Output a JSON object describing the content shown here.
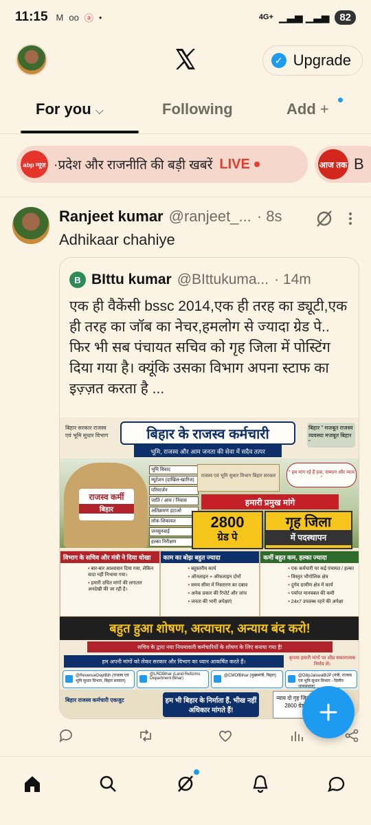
{
  "status_bar": {
    "time": "11:15",
    "network": "4G+",
    "battery": "82"
  },
  "header": {
    "upgrade_label": "Upgrade"
  },
  "tabs": {
    "for_you": "For you",
    "following": "Following",
    "add": "Add"
  },
  "news_banner": {
    "channel": "abp न्यूज़",
    "text": "·प्रदेश और राजनीति की बड़ी खबरें",
    "live": "LIVE",
    "second_channel": "आज तक",
    "second_text": "B"
  },
  "tweet": {
    "author_name": "Ranjeet kumar",
    "author_handle": "@ranjeet_...",
    "time": "· 8s",
    "text": "Adhikaar chahiye"
  },
  "quote": {
    "avatar_letter": "B",
    "author_name": "BIttu kumar",
    "author_handle": "@BIttukuma...",
    "time": "· 14m",
    "text": "एक ही वैकेंसी bssc 2014,एक ही तरह का ड्यूटी,एक ही तरह का जॉब का नेचर,हमलोग से ज्यादा ग्रेड पे.. फिर भी सब पंचायत सचिव को गृह जिला में पोस्टिंग दिया गया है। क्यूंकि उसका विभाग अपना स्टाफ का इज़्ज़त करता है ..."
  },
  "poster": {
    "gov_label": "बिहार सरकार राजस्व एवं भूमि सुधार विभाग",
    "title": "बिहार के राजस्व कर्मचारी",
    "subtitle": "भूमि, राजस्व और आम जनता की सेवा में सदैव तत्पर",
    "map_text": "बिहार \" मजबूत राजस्व व्यवस्था मजबूत बिहार \"",
    "man_label_top": "राजस्व कर्मी",
    "man_label_bottom": "बिहार",
    "signs": [
      "भूमि विवाद",
      "म्यूटेशन (दाखिल-खारिज)",
      "परिमार्जन",
      "जाति / आय / निवास",
      "अतिक्रमण हटाओ",
      "लोक शिकायत",
      "जनसुनवाई",
      "हल्का निरीक्षण"
    ],
    "building": "राजस्व एवं भूमि सुधार विभाग बिहार सरकार",
    "slogan": "\" हम मांग रहे हैं हक, सम्मान और न्याय \"",
    "demand_title": "हमारी प्रमुख मांगे",
    "demand1_big": "2800",
    "demand1_small": "ग्रेड पे",
    "demand2_big": "गृह जिला",
    "demand2_small": "में पदस्थापन",
    "col1_title": "विभाग के सचिव और मंत्री ने दिया धोखा",
    "col1_items": [
      "बार-बार आश्वासन दिया गया, लेकिन वादा नहीं निभाया गया।",
      "हमारी उचित मांगों की लगातार अनदेखी की जा रही है।"
    ],
    "col2_title": "काम का बोझ बहुत ज्यादा",
    "col2_items": [
      "बहुस्तरीय कार्य",
      "ऑनलाइन + ऑफलाइन दोनों",
      "समय सीमा में निस्तारण का दबाव",
      "अनेक प्रकार की रिपोर्ट और जांच",
      "जनता की भारी अपेक्षाएं"
    ],
    "col3_title": "कर्मी बहुत कम, हल्का ज्यादा",
    "col3_items": [
      "एक कर्मचारी पर कई पंचायत / हल्का",
      "विस्तृत भौगोलिक क्षेत्र",
      "दुर्गम ग्रामीण क्षेत्र में कार्य",
      "पर्याप्त मानवबल की कमी",
      "24x7 उपलब्ध रहने की अपेक्षा"
    ],
    "big_slogan": "बहुत हुआ शोषण, अत्याचार, अन्याय बंद करो!",
    "red_bar": "सचिव के द्वारा नया नियमावली कर्मचारियों के शोषण के लिए बनाया गया है!",
    "blue_bar": "हम अपनी मांगों को लेकर सरकार और विभाग का ध्यान आकर्षित करते हैं।",
    "blue_note": "कृपया हमारी मांगों पर शीघ्र सकारात्मक निर्णय लें।",
    "handles": [
      "@RevenueDeptBih (राजस्व एवं भूमि सुधार विभाग, बिहार सरकार)",
      "@LRDBihar (Land Reforms Department Bihar)",
      "@CMOfBihar (मुख्यमंत्री, बिहार)",
      "@DilipJaiswalBJP (मंत्री, राजस्व एवं भूमि सुधार विभाग - दिलीप जायसवाल)"
    ],
    "foot_left": "बिहार राजस्व कर्मचारी एकजुट",
    "foot_center": "हम भी बिहार के निर्माता हैं, भीख नहीं अधिकार मांगते हैं!",
    "foot_right": "न्याय दो गृह जिला दो 2800 ग्रेड पे"
  },
  "icons": {
    "header": [
      "x-logo",
      "verified-badge-icon"
    ],
    "tweet": [
      "grok-icon",
      "more-icon"
    ],
    "actions": [
      "reply-icon",
      "retweet-icon",
      "like-icon",
      "views-icon",
      "bookmark-icon",
      "share-icon"
    ],
    "bottom_nav": [
      "home-icon",
      "search-icon",
      "grok-icon",
      "notifications-icon",
      "messages-icon"
    ]
  },
  "colors": {
    "background": "#fbf4e4",
    "accent": "#1d9bf0",
    "live": "#e63b2e"
  }
}
